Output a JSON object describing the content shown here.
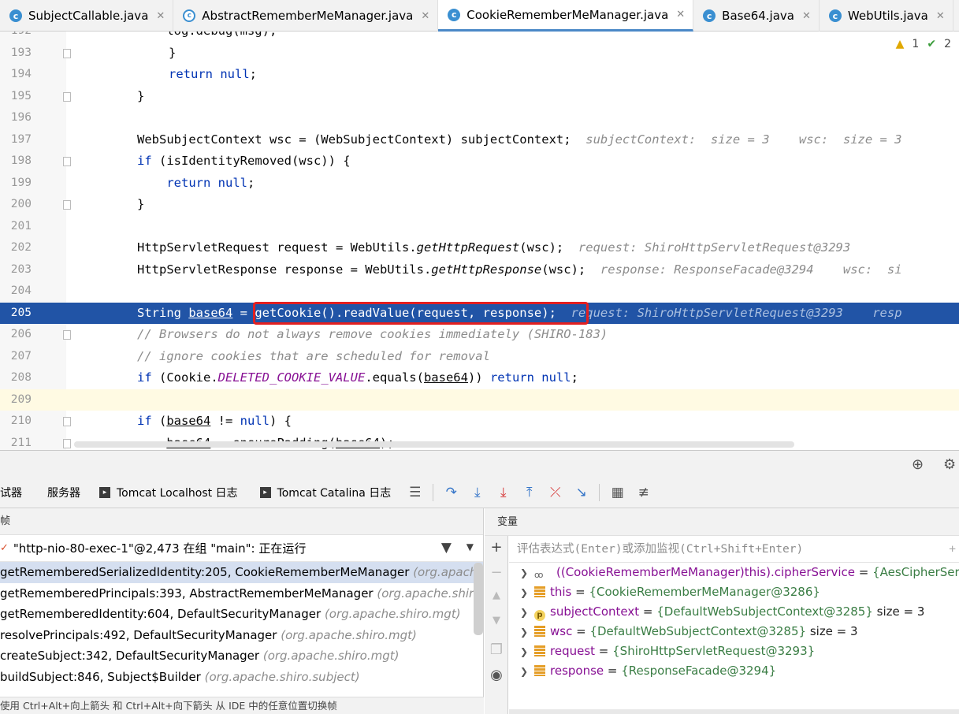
{
  "tabs": [
    {
      "label": "SubjectCallable.java",
      "icon": "class-icon",
      "active": false
    },
    {
      "label": "AbstractRememberMeManager.java",
      "icon": "abstract-class-icon",
      "active": false
    },
    {
      "label": "CookieRememberMeManager.java",
      "icon": "class-icon",
      "active": true
    },
    {
      "label": "Base64.java",
      "icon": "class-icon",
      "active": false
    },
    {
      "label": "WebUtils.java",
      "icon": "class-icon",
      "active": false
    }
  ],
  "inspections": {
    "warnings": "1",
    "checks": "2"
  },
  "editor": {
    "lines": [
      {
        "n": "192",
        "parts": [
          [
            "",
            "    log.debug(msg);"
          ]
        ]
      },
      {
        "n": "193",
        "parts": [
          [
            "",
            "}"
          ]
        ]
      },
      {
        "n": "194",
        "parts": [
          [
            "kw",
            "return null"
          ],
          [
            "",
            ";"
          ]
        ]
      },
      {
        "n": "195",
        "parts": [
          [
            "",
            "}"
          ]
        ]
      },
      {
        "n": "196",
        "parts": []
      },
      {
        "n": "197",
        "parts": [
          [
            "",
            "WebSubjectContext wsc = (WebSubjectContext) subjectContext;  "
          ],
          [
            "hint",
            "subjectContext:  size = 3    wsc:  size = 3"
          ]
        ]
      },
      {
        "n": "198",
        "parts": [
          [
            "kw",
            "if"
          ],
          [
            "",
            " (isIdentityRemoved(wsc)) {"
          ]
        ]
      },
      {
        "n": "199",
        "parts": [
          [
            "kw",
            "    return null"
          ],
          [
            "",
            ";"
          ]
        ]
      },
      {
        "n": "200",
        "parts": [
          [
            "",
            "}"
          ]
        ]
      },
      {
        "n": "201",
        "parts": []
      },
      {
        "n": "202",
        "parts": [
          [
            "",
            "HttpServletRequest request = WebUtils."
          ],
          [
            "it",
            "getHttpRequest"
          ],
          [
            "",
            "(wsc);  "
          ],
          [
            "hint",
            "request: ShiroHttpServletRequest@3293"
          ]
        ]
      },
      {
        "n": "203",
        "parts": [
          [
            "",
            "HttpServletResponse response = WebUtils."
          ],
          [
            "it",
            "getHttpResponse"
          ],
          [
            "",
            "(wsc);  "
          ],
          [
            "hint",
            "response: ResponseFacade@3294    wsc:  si"
          ]
        ]
      },
      {
        "n": "204",
        "parts": []
      },
      {
        "n": "205",
        "parts": [
          [
            "",
            "String "
          ],
          [
            "ul",
            "base64"
          ],
          [
            "",
            " = getCookie().readValue(request, response);  "
          ],
          [
            "hint",
            "request: ShiroHttpServletRequest@3293    resp"
          ]
        ]
      },
      {
        "n": "206",
        "parts": [
          [
            "cm",
            "// Browsers do not always remove cookies immediately (SHIRO-183)"
          ]
        ]
      },
      {
        "n": "207",
        "parts": [
          [
            "cm",
            "// ignore cookies that are scheduled for removal"
          ]
        ]
      },
      {
        "n": "208",
        "parts": [
          [
            "kw",
            "if"
          ],
          [
            "",
            " (Cookie."
          ],
          [
            "const",
            "DELETED_COOKIE_VALUE"
          ],
          [
            "",
            ".equals("
          ],
          [
            "ul",
            "base64"
          ],
          [
            "",
            ")) "
          ],
          [
            "kw",
            "return null"
          ],
          [
            "",
            ";"
          ]
        ]
      },
      {
        "n": "209",
        "parts": []
      },
      {
        "n": "210",
        "parts": [
          [
            "kw",
            "if"
          ],
          [
            "",
            " ("
          ],
          [
            "ul",
            "base64"
          ],
          [
            "",
            " != "
          ],
          [
            "kw",
            "null"
          ],
          [
            "",
            ") {"
          ]
        ]
      },
      {
        "n": "211",
        "parts": [
          [
            "",
            "    "
          ],
          [
            "ul",
            "base64"
          ],
          [
            "",
            " = ensurePadding("
          ],
          [
            "ul",
            "base64"
          ],
          [
            "",
            ");"
          ]
        ]
      }
    ]
  },
  "debug_tabs": [
    {
      "label": "调试器",
      "icon": ""
    },
    {
      "label": "服务器",
      "icon": ""
    },
    {
      "label": "Tomcat Localhost 日志",
      "icon": "console-icon"
    },
    {
      "label": "Tomcat Catalina 日志",
      "icon": "console-icon"
    }
  ],
  "frames": {
    "title": "帧",
    "thread": "\"http-nio-80-exec-1\"@2,473 在组 \"main\": 正在运行",
    "items": [
      {
        "method": "getRememberedSerializedIdentity:205, CookieRememberMeManager ",
        "pkg": "(org.apache.s",
        "selected": true
      },
      {
        "method": "getRememberedPrincipals:393, AbstractRememberMeManager ",
        "pkg": "(org.apache.shiro.m",
        "selected": false
      },
      {
        "method": "getRememberedIdentity:604, DefaultSecurityManager ",
        "pkg": "(org.apache.shiro.mgt)",
        "selected": false
      },
      {
        "method": "resolvePrincipals:492, DefaultSecurityManager ",
        "pkg": "(org.apache.shiro.mgt)",
        "selected": false
      },
      {
        "method": "createSubject:342, DefaultSecurityManager ",
        "pkg": "(org.apache.shiro.mgt)",
        "selected": false
      },
      {
        "method": "buildSubject:846, Subject$Builder ",
        "pkg": "(org.apache.shiro.subject)",
        "selected": false
      }
    ],
    "hint": "使用 Ctrl+Alt+向上箭头 和 Ctrl+Alt+向下箭头 从 IDE 中的任意位置切换帧"
  },
  "variables": {
    "title": "变量",
    "eval_placeholder": "评估表达式(Enter)或添加监视(Ctrl+Shift+Enter)",
    "items": [
      {
        "icon": "watch",
        "name": "((CookieRememberMeManager)this).cipherService",
        "value": "{AesCipherService",
        "size": ""
      },
      {
        "icon": "field",
        "name": "this",
        "value": "{CookieRememberMeManager@3286}",
        "size": ""
      },
      {
        "icon": "param",
        "name": "subjectContext",
        "value": "{DefaultWebSubjectContext@3285}",
        "size": "size = 3"
      },
      {
        "icon": "field",
        "name": "wsc",
        "value": "{DefaultWebSubjectContext@3285}",
        "size": "size = 3"
      },
      {
        "icon": "field",
        "name": "request",
        "value": "{ShiroHttpServletRequest@3293}",
        "size": ""
      },
      {
        "icon": "field",
        "name": "response",
        "value": "{ResponseFacade@3294}",
        "size": ""
      }
    ]
  }
}
